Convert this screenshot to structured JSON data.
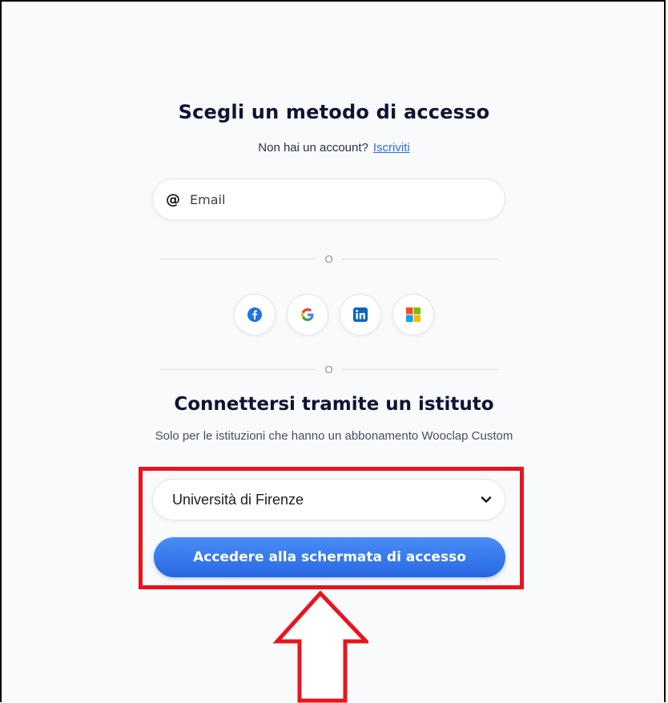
{
  "login": {
    "title": "Scegli un metodo di accesso",
    "no_account_text": "Non hai un account?",
    "signup_link": "Iscriviti",
    "email_placeholder": "Email",
    "separator_1": "O",
    "separator_2": "O",
    "social_buttons": [
      "facebook-icon",
      "google-icon",
      "linkedin-icon",
      "microsoft-icon"
    ]
  },
  "institution": {
    "title": "Connettersi tramite un istituto",
    "subtitle": "Solo per le istituzioni che hanno un abbonamento Wooclap Custom",
    "selected_institution": "Università di Firenze",
    "access_button": "Accedere alla schermata di accesso"
  },
  "annotation": {
    "highlight_color": "#e8141f",
    "arrow_direction": "up"
  },
  "colors": {
    "primary": "#2f6fe4",
    "title_text": "#101332"
  }
}
